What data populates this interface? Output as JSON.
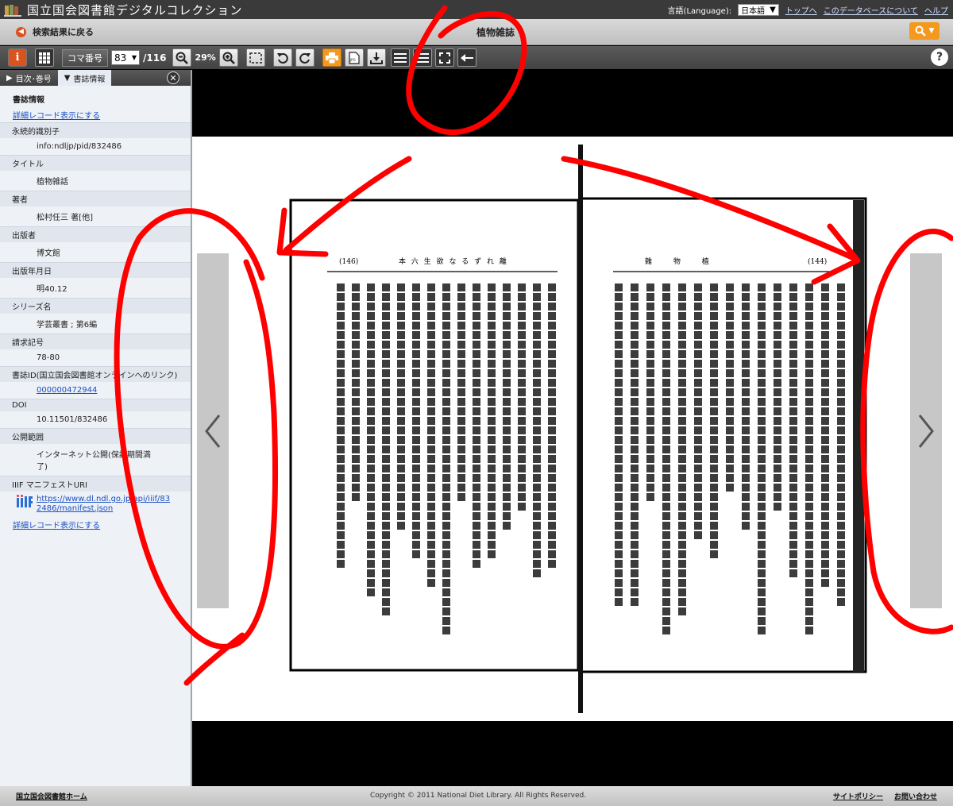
{
  "topbar": {
    "site_title": "国立国会図書館デジタルコレクション",
    "language_label": "言語(Language):",
    "language_value": "日本語",
    "links": [
      "トップへ",
      "このデータベースについて",
      "ヘルプ"
    ]
  },
  "header": {
    "back_label": "検索結果に戻る",
    "doc_title": "植物雑誌"
  },
  "toolbar": {
    "koma_label": "コマ番号",
    "koma_value": "83",
    "koma_total": "/116",
    "zoom": "29%"
  },
  "sidebar": {
    "tabs": [
      "目次･巻号",
      "書誌情報"
    ],
    "heading": "書誌情報",
    "detail_link": "詳細レコード表示にする",
    "fields": [
      {
        "label": "永続的識別子",
        "value": "info:ndljp/pid/832486"
      },
      {
        "label": "タイトル",
        "value": "植物雑話"
      },
      {
        "label": "著者",
        "value": "松村任三 著[他]"
      },
      {
        "label": "出版者",
        "value": "博文館"
      },
      {
        "label": "出版年月日",
        "value": "明40.12"
      },
      {
        "label": "シリーズ名",
        "value": "学芸叢書 ; 第6編"
      },
      {
        "label": "請求記号",
        "value": "78-80"
      },
      {
        "label": "書誌ID(国立国会図書館オンラインへのリンク)",
        "value": "000000472944"
      },
      {
        "label": "DOI",
        "value": "10.11501/832486"
      },
      {
        "label": "公開範囲",
        "value": "インターネット公開(保護期間満了)"
      },
      {
        "label": "IIIF マニフェストURI",
        "value": "https://www.dl.ndl.go.jp/api/iiif/832486/manifest.json"
      }
    ],
    "detail_link_bottom": "詳細レコード表示にする"
  },
  "book": {
    "left_page_number": "(146)",
    "left_running_head": "本 六 生 欲 な る ず れ 離",
    "right_page_number": "(144)",
    "right_running_head": "雜 物 植"
  },
  "footer": {
    "home_link": "国立国会図書館ホーム",
    "copyright": "Copyright © 2011 National Diet Library. All Rights Reserved.",
    "right_links": [
      "サイトポリシー",
      "お問い合わせ"
    ]
  },
  "colors": {
    "accent_orange": "#f39a1e",
    "info_red": "#d9531e",
    "annotation_red": "#ff0000"
  }
}
